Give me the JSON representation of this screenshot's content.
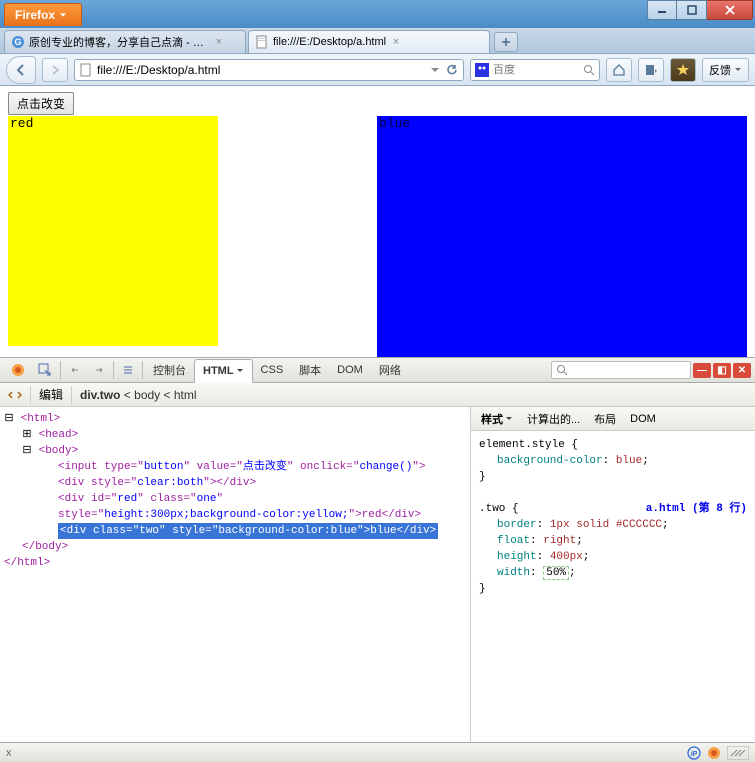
{
  "titlebar": {
    "firefox_label": "Firefox"
  },
  "tabs": {
    "tab1_label": "原创专业的博客，分享自己点滴 - 博...",
    "tab2_label": "file:///E:/Desktop/a.html"
  },
  "navbar": {
    "url": "file:///E:/Desktop/a.html",
    "search_placeholder": "百度",
    "feedback_label": "反馈"
  },
  "page": {
    "button_label": "点击改变",
    "red_text": "red",
    "blue_text": "blue"
  },
  "firebug": {
    "tabs": {
      "console": "控制台",
      "html": "HTML",
      "css": "CSS",
      "script": "脚本",
      "dom": "DOM",
      "net": "网络"
    },
    "crumb": {
      "edit": "编辑",
      "path_strong": "div.two",
      "path_rest": " < body < html"
    },
    "side_tabs": {
      "style": "样式",
      "computed": "计算出的...",
      "layout": "布局",
      "dom": "DOM"
    },
    "html": {
      "l1": "<html>",
      "l2": "<head>",
      "l3": "<body>",
      "l4_a": "<input type=\"",
      "l4_b": "button",
      "l4_c": "\" value=\"",
      "l4_d": "点击改变",
      "l4_e": "\" onclick=\"",
      "l4_f": "change()",
      "l4_g": "\">",
      "l5_a": "<div style=\"",
      "l5_b": "clear:both",
      "l5_c": "\"></div>",
      "l6_a": "<div id=\"",
      "l6_b": "red",
      "l6_c": "\" class=\"",
      "l6_d": "one",
      "l6_e": "\" style=\"",
      "l6_f": "height:300px;background-",
      "l6_g": "color:yellow;",
      "l6_h": "\">red</div>",
      "l7": "<div class=\"two\" style=\"background-color:blue\">blue</div>",
      "l8": "</body>",
      "l9": "</html>"
    },
    "css": {
      "sel1": "element.style {",
      "p1": "background-color",
      "v1": "blue",
      "close": "}",
      "file": "a.html (第 8 行)",
      "sel2": ".two {",
      "p2": "border",
      "v2": "1px solid #CCCCCC",
      "p3": "float",
      "v3": "right",
      "p4": "height",
      "v4": "400px",
      "p5": "width",
      "v5": "50%"
    }
  },
  "statusbar": {
    "x": "x"
  }
}
